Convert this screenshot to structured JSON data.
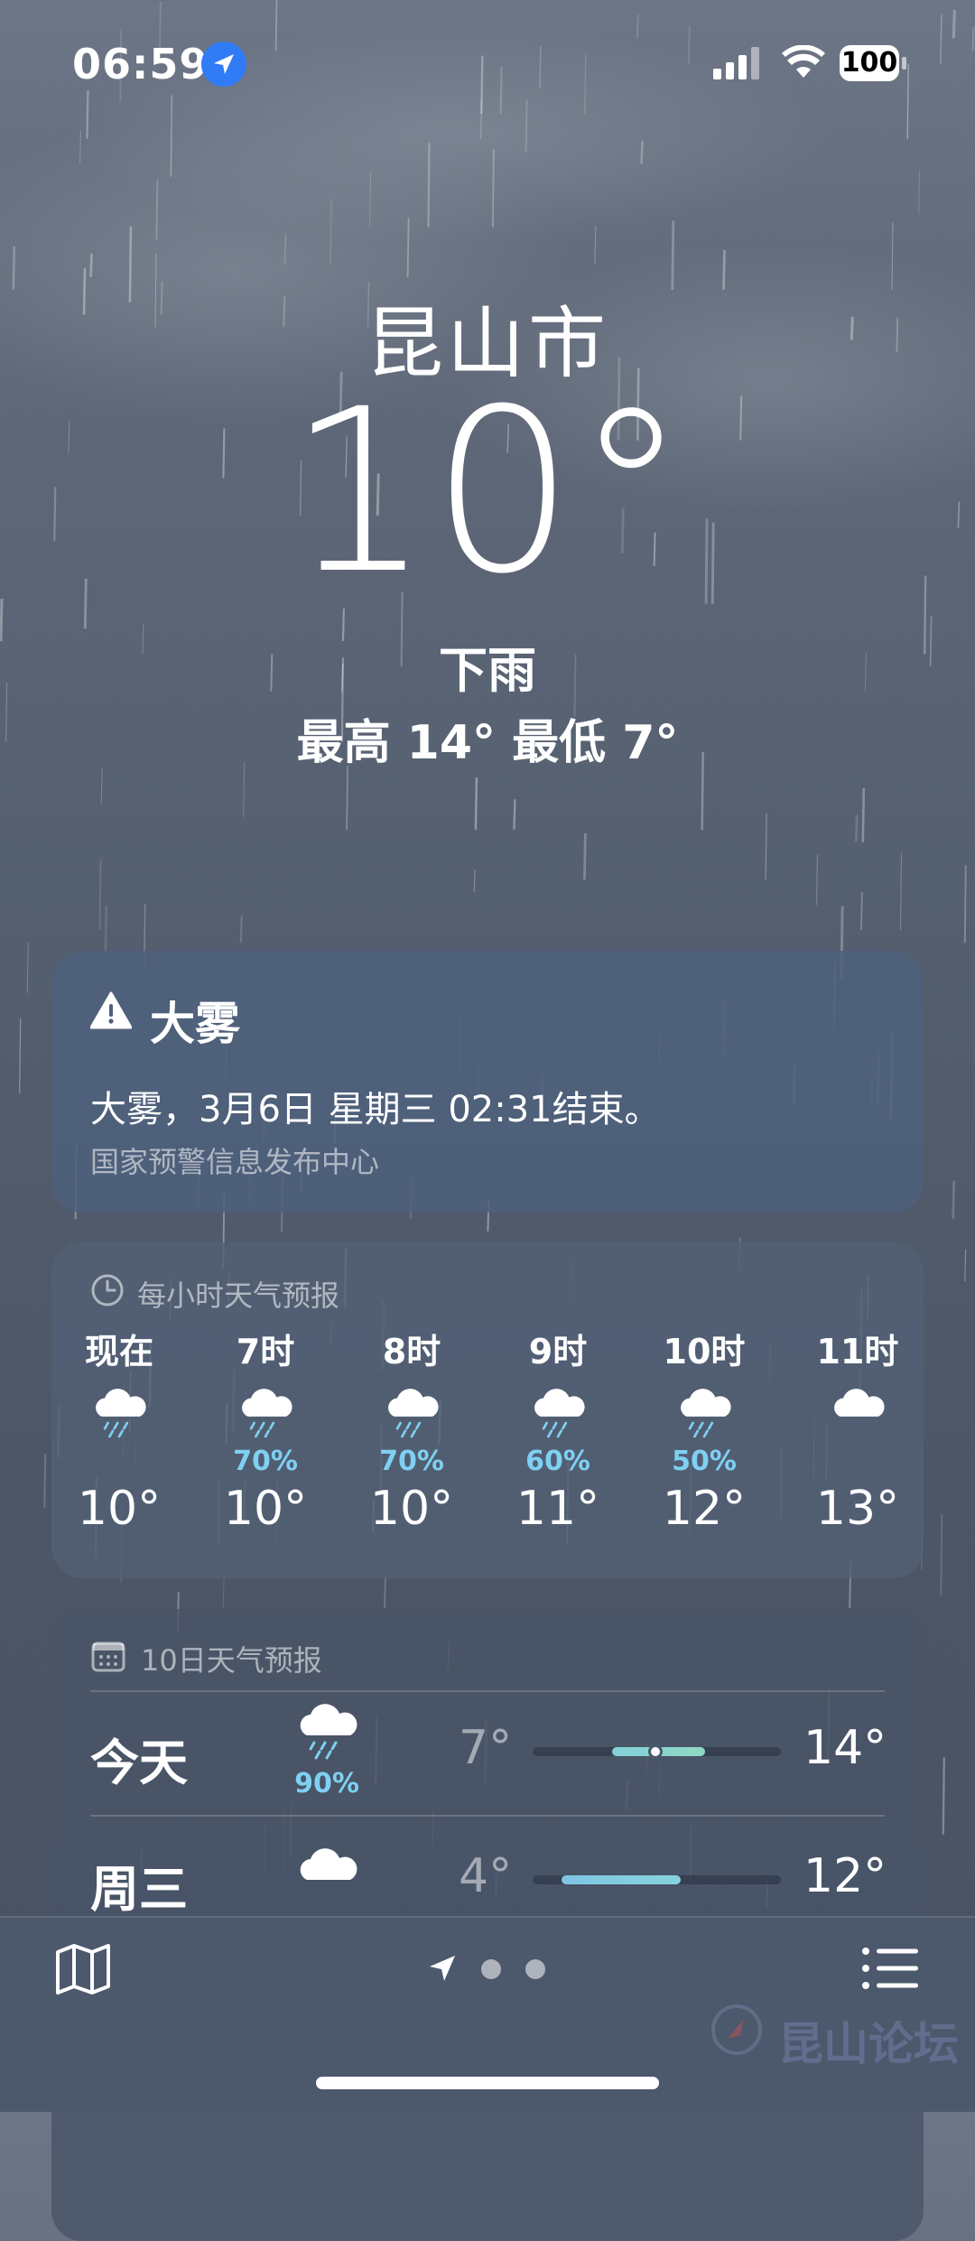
{
  "status_bar": {
    "time": "06:59",
    "battery": "100"
  },
  "location": {
    "city": "昆山市",
    "temperature": "10°",
    "condition": "下雨",
    "high_low": "最高 14°  最低 7°"
  },
  "alert": {
    "title": "大雾",
    "body": "大雾，3月6日 星期三 02:31结束。",
    "source": "国家预警信息发布中心"
  },
  "hourly": {
    "header": "每小时天气预报",
    "items": [
      {
        "time": "现在",
        "icon": "rain-icon",
        "pop": "",
        "temp": "10°"
      },
      {
        "time": "7时",
        "icon": "rain-icon",
        "pop": "70%",
        "temp": "10°"
      },
      {
        "time": "8时",
        "icon": "rain-icon",
        "pop": "70%",
        "temp": "10°"
      },
      {
        "time": "9时",
        "icon": "rain-icon",
        "pop": "60%",
        "temp": "11°"
      },
      {
        "time": "10时",
        "icon": "rain-icon",
        "pop": "50%",
        "temp": "12°"
      },
      {
        "time": "11时",
        "icon": "cloud-icon",
        "pop": "",
        "temp": "13°"
      }
    ]
  },
  "daily": {
    "header": "10日天气预报",
    "items": [
      {
        "day": "今天",
        "icon": "rain-icon",
        "pop": "90%",
        "low": "7°",
        "high": "14°"
      },
      {
        "day": "周三",
        "icon": "cloud-icon",
        "pop": "",
        "low": "4°",
        "high": "12°"
      }
    ]
  },
  "watermark": "昆山论坛",
  "colors": {
    "precip": "#7fd0f2",
    "location_dot": "#2f7cf6",
    "temp_bar": "#86d5cf"
  }
}
